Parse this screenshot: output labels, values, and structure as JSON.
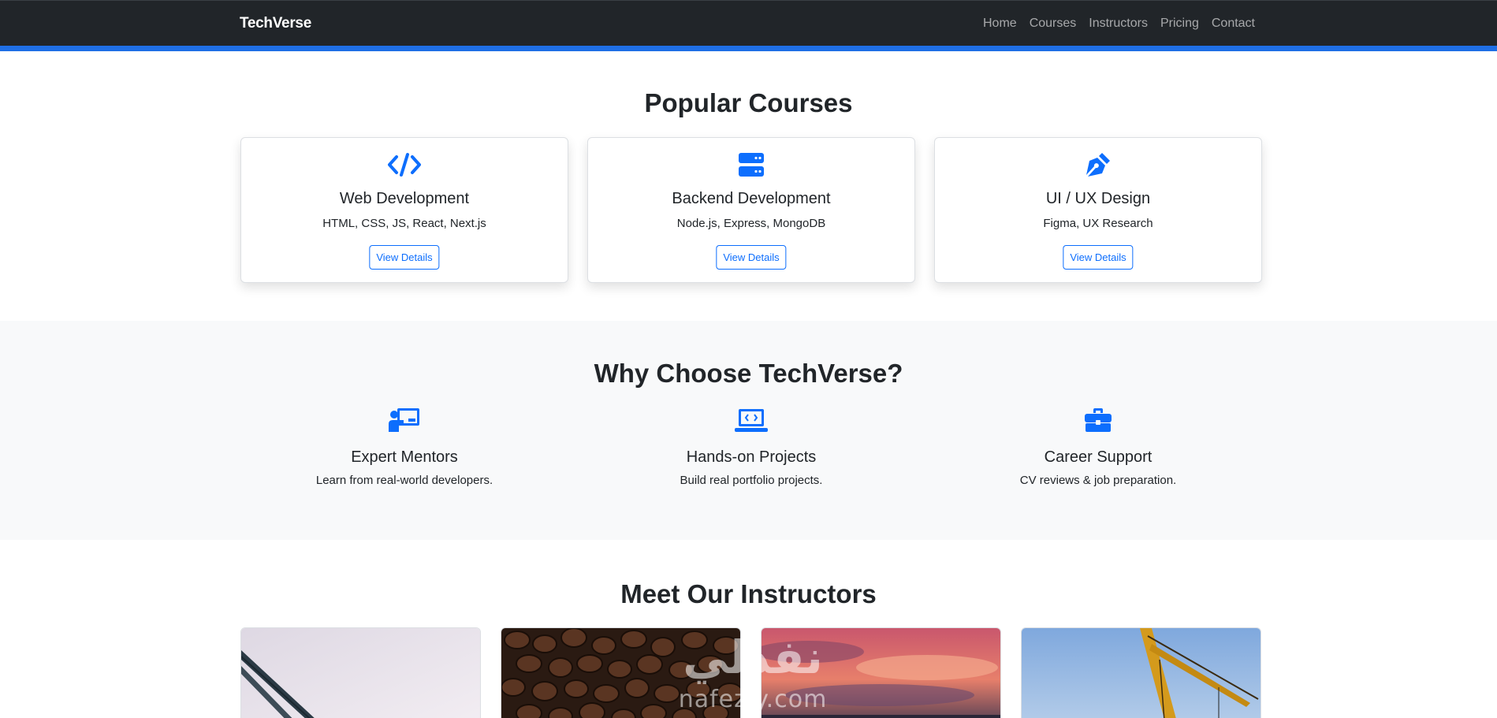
{
  "navbar": {
    "brand": "TechVerse",
    "links": [
      "Home",
      "Courses",
      "Instructors",
      "Pricing",
      "Contact"
    ],
    "accent_color": "#1f6fe5",
    "background_color": "#212529"
  },
  "courses": {
    "title": "Popular Courses",
    "items": [
      {
        "icon": "code-icon",
        "title": "Web Development",
        "subtitle": "HTML, CSS, JS, React, Next.js",
        "button": "View Details"
      },
      {
        "icon": "server-icon",
        "title": "Backend Development",
        "subtitle": "Node.js, Express, MongoDB",
        "button": "View Details"
      },
      {
        "icon": "pen-nib-icon",
        "title": "UI / UX Design",
        "subtitle": "Figma, UX Research",
        "button": "View Details"
      }
    ]
  },
  "why": {
    "title": "Why Choose TechVerse?",
    "items": [
      {
        "icon": "person-chalkboard-icon",
        "title": "Expert Mentors",
        "desc": "Learn from real-world developers."
      },
      {
        "icon": "laptop-code-icon",
        "title": "Hands-on Projects",
        "desc": "Build real portfolio projects."
      },
      {
        "icon": "briefcase-icon",
        "title": "Career Support",
        "desc": "CV reviews & job preparation."
      }
    ]
  },
  "instructors": {
    "title": "Meet Our Instructors",
    "photos": [
      "stadium-roof-photo",
      "coffee-beans-photo",
      "sunset-clouds-photo",
      "crane-sky-photo"
    ]
  },
  "watermark": {
    "arabic": "نفذلي",
    "latin": "nafezly.com"
  },
  "colors": {
    "primary": "#0d6efd",
    "section_bg": "#f8f9fa"
  }
}
